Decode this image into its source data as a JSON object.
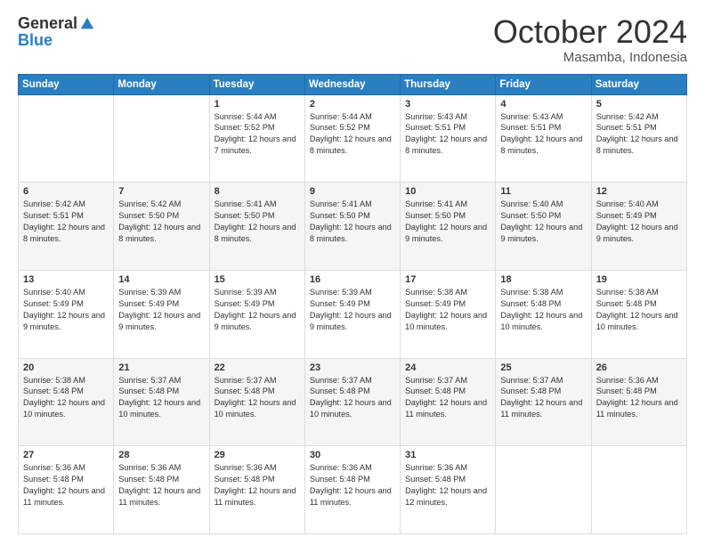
{
  "logo": {
    "general": "General",
    "blue": "Blue"
  },
  "header": {
    "month": "October 2024",
    "location": "Masamba, Indonesia"
  },
  "days_of_week": [
    "Sunday",
    "Monday",
    "Tuesday",
    "Wednesday",
    "Thursday",
    "Friday",
    "Saturday"
  ],
  "weeks": [
    [
      {
        "day": "",
        "sunrise": "",
        "sunset": "",
        "daylight": ""
      },
      {
        "day": "",
        "sunrise": "",
        "sunset": "",
        "daylight": ""
      },
      {
        "day": "1",
        "sunrise": "Sunrise: 5:44 AM",
        "sunset": "Sunset: 5:52 PM",
        "daylight": "Daylight: 12 hours and 7 minutes."
      },
      {
        "day": "2",
        "sunrise": "Sunrise: 5:44 AM",
        "sunset": "Sunset: 5:52 PM",
        "daylight": "Daylight: 12 hours and 8 minutes."
      },
      {
        "day": "3",
        "sunrise": "Sunrise: 5:43 AM",
        "sunset": "Sunset: 5:51 PM",
        "daylight": "Daylight: 12 hours and 8 minutes."
      },
      {
        "day": "4",
        "sunrise": "Sunrise: 5:43 AM",
        "sunset": "Sunset: 5:51 PM",
        "daylight": "Daylight: 12 hours and 8 minutes."
      },
      {
        "day": "5",
        "sunrise": "Sunrise: 5:42 AM",
        "sunset": "Sunset: 5:51 PM",
        "daylight": "Daylight: 12 hours and 8 minutes."
      }
    ],
    [
      {
        "day": "6",
        "sunrise": "Sunrise: 5:42 AM",
        "sunset": "Sunset: 5:51 PM",
        "daylight": "Daylight: 12 hours and 8 minutes."
      },
      {
        "day": "7",
        "sunrise": "Sunrise: 5:42 AM",
        "sunset": "Sunset: 5:50 PM",
        "daylight": "Daylight: 12 hours and 8 minutes."
      },
      {
        "day": "8",
        "sunrise": "Sunrise: 5:41 AM",
        "sunset": "Sunset: 5:50 PM",
        "daylight": "Daylight: 12 hours and 8 minutes."
      },
      {
        "day": "9",
        "sunrise": "Sunrise: 5:41 AM",
        "sunset": "Sunset: 5:50 PM",
        "daylight": "Daylight: 12 hours and 8 minutes."
      },
      {
        "day": "10",
        "sunrise": "Sunrise: 5:41 AM",
        "sunset": "Sunset: 5:50 PM",
        "daylight": "Daylight: 12 hours and 9 minutes."
      },
      {
        "day": "11",
        "sunrise": "Sunrise: 5:40 AM",
        "sunset": "Sunset: 5:50 PM",
        "daylight": "Daylight: 12 hours and 9 minutes."
      },
      {
        "day": "12",
        "sunrise": "Sunrise: 5:40 AM",
        "sunset": "Sunset: 5:49 PM",
        "daylight": "Daylight: 12 hours and 9 minutes."
      }
    ],
    [
      {
        "day": "13",
        "sunrise": "Sunrise: 5:40 AM",
        "sunset": "Sunset: 5:49 PM",
        "daylight": "Daylight: 12 hours and 9 minutes."
      },
      {
        "day": "14",
        "sunrise": "Sunrise: 5:39 AM",
        "sunset": "Sunset: 5:49 PM",
        "daylight": "Daylight: 12 hours and 9 minutes."
      },
      {
        "day": "15",
        "sunrise": "Sunrise: 5:39 AM",
        "sunset": "Sunset: 5:49 PM",
        "daylight": "Daylight: 12 hours and 9 minutes."
      },
      {
        "day": "16",
        "sunrise": "Sunrise: 5:39 AM",
        "sunset": "Sunset: 5:49 PM",
        "daylight": "Daylight: 12 hours and 9 minutes."
      },
      {
        "day": "17",
        "sunrise": "Sunrise: 5:38 AM",
        "sunset": "Sunset: 5:49 PM",
        "daylight": "Daylight: 12 hours and 10 minutes."
      },
      {
        "day": "18",
        "sunrise": "Sunrise: 5:38 AM",
        "sunset": "Sunset: 5:48 PM",
        "daylight": "Daylight: 12 hours and 10 minutes."
      },
      {
        "day": "19",
        "sunrise": "Sunrise: 5:38 AM",
        "sunset": "Sunset: 5:48 PM",
        "daylight": "Daylight: 12 hours and 10 minutes."
      }
    ],
    [
      {
        "day": "20",
        "sunrise": "Sunrise: 5:38 AM",
        "sunset": "Sunset: 5:48 PM",
        "daylight": "Daylight: 12 hours and 10 minutes."
      },
      {
        "day": "21",
        "sunrise": "Sunrise: 5:37 AM",
        "sunset": "Sunset: 5:48 PM",
        "daylight": "Daylight: 12 hours and 10 minutes."
      },
      {
        "day": "22",
        "sunrise": "Sunrise: 5:37 AM",
        "sunset": "Sunset: 5:48 PM",
        "daylight": "Daylight: 12 hours and 10 minutes."
      },
      {
        "day": "23",
        "sunrise": "Sunrise: 5:37 AM",
        "sunset": "Sunset: 5:48 PM",
        "daylight": "Daylight: 12 hours and 10 minutes."
      },
      {
        "day": "24",
        "sunrise": "Sunrise: 5:37 AM",
        "sunset": "Sunset: 5:48 PM",
        "daylight": "Daylight: 12 hours and 11 minutes."
      },
      {
        "day": "25",
        "sunrise": "Sunrise: 5:37 AM",
        "sunset": "Sunset: 5:48 PM",
        "daylight": "Daylight: 12 hours and 11 minutes."
      },
      {
        "day": "26",
        "sunrise": "Sunrise: 5:36 AM",
        "sunset": "Sunset: 5:48 PM",
        "daylight": "Daylight: 12 hours and 11 minutes."
      }
    ],
    [
      {
        "day": "27",
        "sunrise": "Sunrise: 5:36 AM",
        "sunset": "Sunset: 5:48 PM",
        "daylight": "Daylight: 12 hours and 11 minutes."
      },
      {
        "day": "28",
        "sunrise": "Sunrise: 5:36 AM",
        "sunset": "Sunset: 5:48 PM",
        "daylight": "Daylight: 12 hours and 11 minutes."
      },
      {
        "day": "29",
        "sunrise": "Sunrise: 5:36 AM",
        "sunset": "Sunset: 5:48 PM",
        "daylight": "Daylight: 12 hours and 11 minutes."
      },
      {
        "day": "30",
        "sunrise": "Sunrise: 5:36 AM",
        "sunset": "Sunset: 5:48 PM",
        "daylight": "Daylight: 12 hours and 11 minutes."
      },
      {
        "day": "31",
        "sunrise": "Sunrise: 5:36 AM",
        "sunset": "Sunset: 5:48 PM",
        "daylight": "Daylight: 12 hours and 12 minutes."
      },
      {
        "day": "",
        "sunrise": "",
        "sunset": "",
        "daylight": ""
      },
      {
        "day": "",
        "sunrise": "",
        "sunset": "",
        "daylight": ""
      }
    ]
  ]
}
